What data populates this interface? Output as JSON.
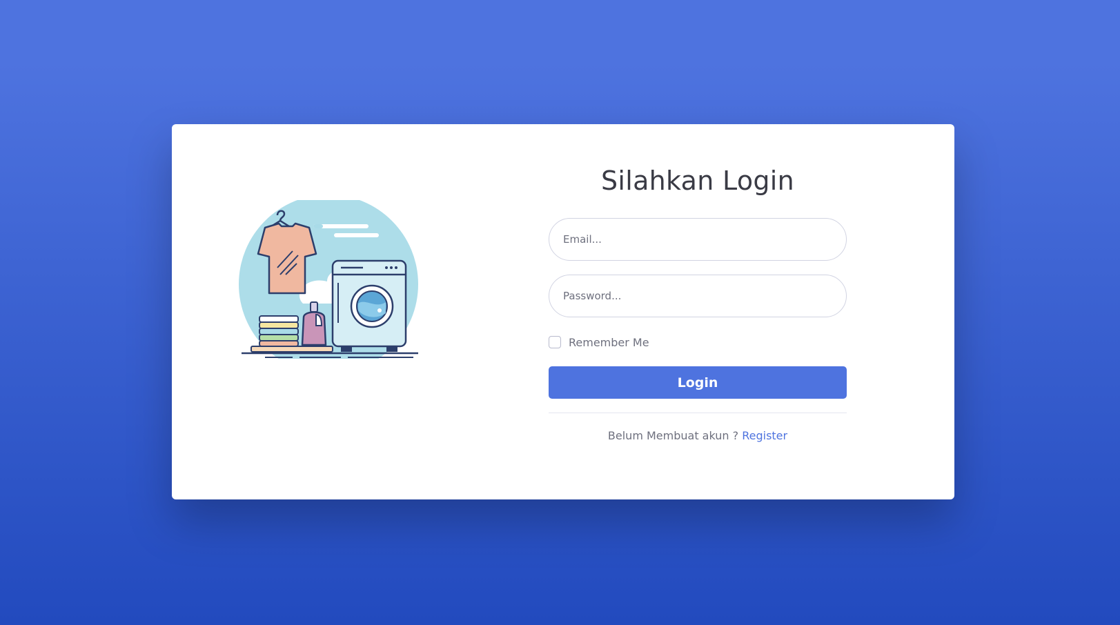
{
  "login": {
    "title": "Silahkan Login",
    "email_placeholder": "Email...",
    "password_placeholder": "Password...",
    "remember_label": "Remember Me",
    "login_button": "Login",
    "register_prompt": "Belum Membuat akun ?",
    "register_link": "Register"
  },
  "illustration": {
    "icon": "laundry-illustration"
  },
  "colors": {
    "background_top": "#4e73df",
    "background_bottom": "#224abe",
    "primary": "#4e73df",
    "text": "#3a3b45",
    "muted": "#6e707e"
  }
}
